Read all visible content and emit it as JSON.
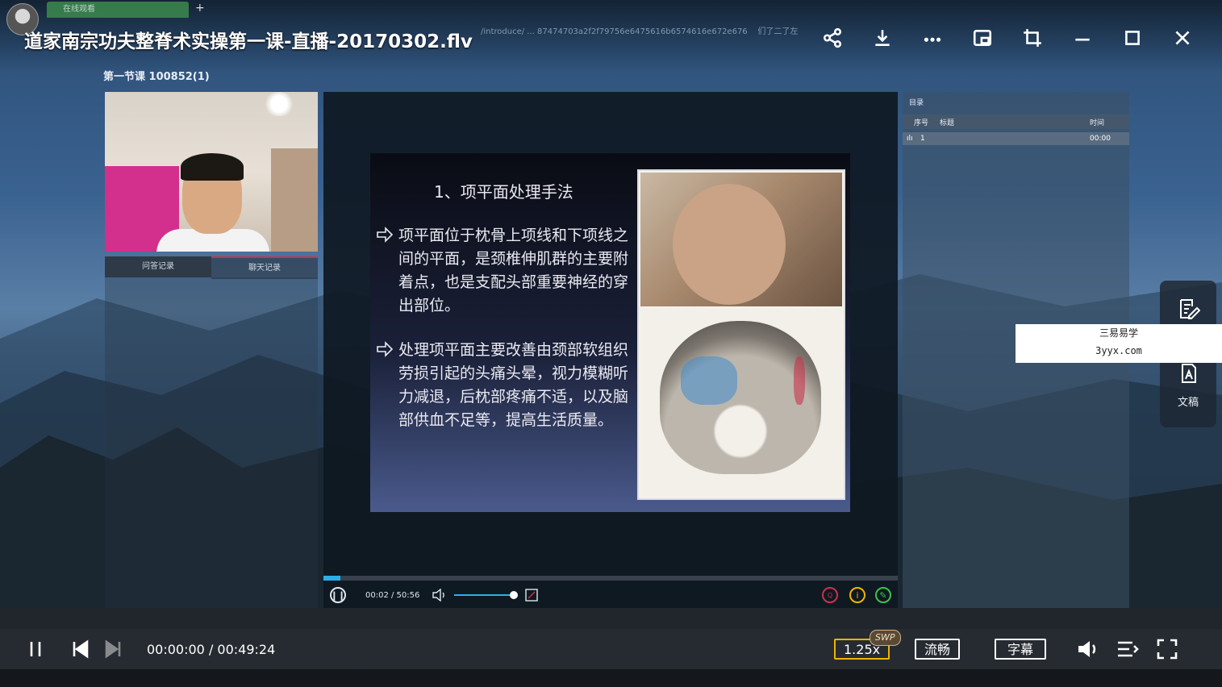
{
  "window": {
    "title": "道家南宗功夫整脊术实操第一课-直播-20170302.flv",
    "browser_tab": "在线观看",
    "url_fragment": "/introduce/ ... 87474703a2f2f79756e6475616b6574616e672e676",
    "search_hint": "们了二了左"
  },
  "top_icons": [
    "share-icon",
    "download-icon",
    "more-icon",
    "pip-icon",
    "crop-icon",
    "minimize-icon",
    "maximize-icon",
    "close-icon"
  ],
  "lesson": {
    "label": "第一节课 100852(1)",
    "tabs": [
      "问答记录",
      "聊天记录"
    ]
  },
  "slide": {
    "title": "1、项平面处理手法",
    "bullets": [
      "项平面位于枕骨上项线和下项线之间的平面，是颈椎伸肌群的主要附着点，也是支配头部重要神经的穿出部位。",
      "处理项平面主要改善由颈部软组织劳损引起的头痛头晕，视力模糊听力减退，后枕部疼痛不适，以及脑部供血不足等，提高生活质量。"
    ]
  },
  "player": {
    "time": "00:02 / 50:56",
    "progress": 0.03,
    "volume": 0.9
  },
  "catalog": {
    "title": "目录",
    "columns": [
      "序号",
      "标题",
      "时间"
    ],
    "rows": [
      {
        "index": "1",
        "title": "",
        "time": "00:00"
      }
    ]
  },
  "floating": {
    "doc_label": "文稿"
  },
  "watermark": {
    "line1": "三易易学",
    "line2": "3yyx.com"
  },
  "bottom": {
    "time": "00:00:00 / 00:49:24",
    "speed": "1.25x",
    "swp": "SWP",
    "quality": "流畅",
    "subtitle": "字幕"
  },
  "colors": {
    "accent_blue": "#2ab0e8",
    "speed_border": "#f0b400",
    "tab_red": "#c8334b"
  }
}
